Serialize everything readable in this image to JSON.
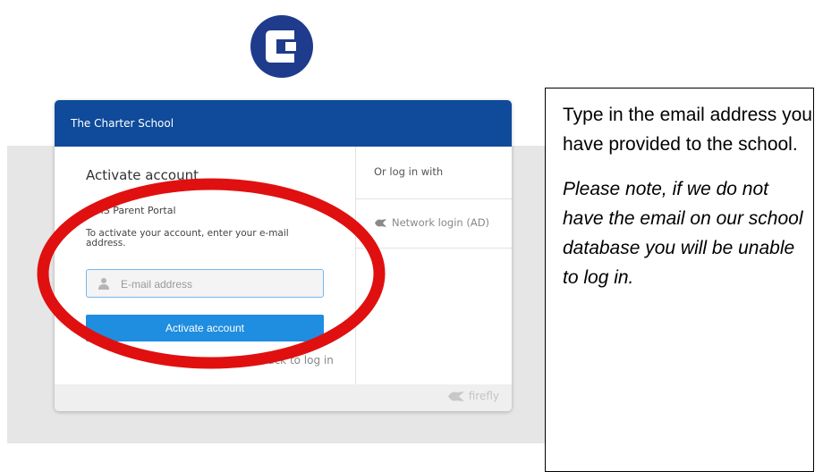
{
  "logo": {
    "icon": "charter-school-logo-icon",
    "color": "#1f3b8c"
  },
  "card": {
    "header_title": "The Charter School",
    "activate": {
      "title": "Activate account",
      "subtitle": "SIMS Parent Portal",
      "instructions": "To activate your account, enter your e-mail address.",
      "email_placeholder": "E-mail address",
      "email_value": "",
      "button_label": "Activate account",
      "back_link": "Back to log in"
    },
    "alt_login": {
      "heading": "Or log in with",
      "network_login": "Network login (AD)"
    },
    "footer_brand": "firefly"
  },
  "annotation": {
    "callout_text": "Type in the email address you have provided to the school.",
    "callout_note": "Please note, if we do not have the email on our school database you will be unable to log in.",
    "highlight_color": "#e01010"
  },
  "colors": {
    "header_bg": "#0f4b9a",
    "button_bg": "#1f8de0",
    "input_border": "#79b8ec"
  }
}
